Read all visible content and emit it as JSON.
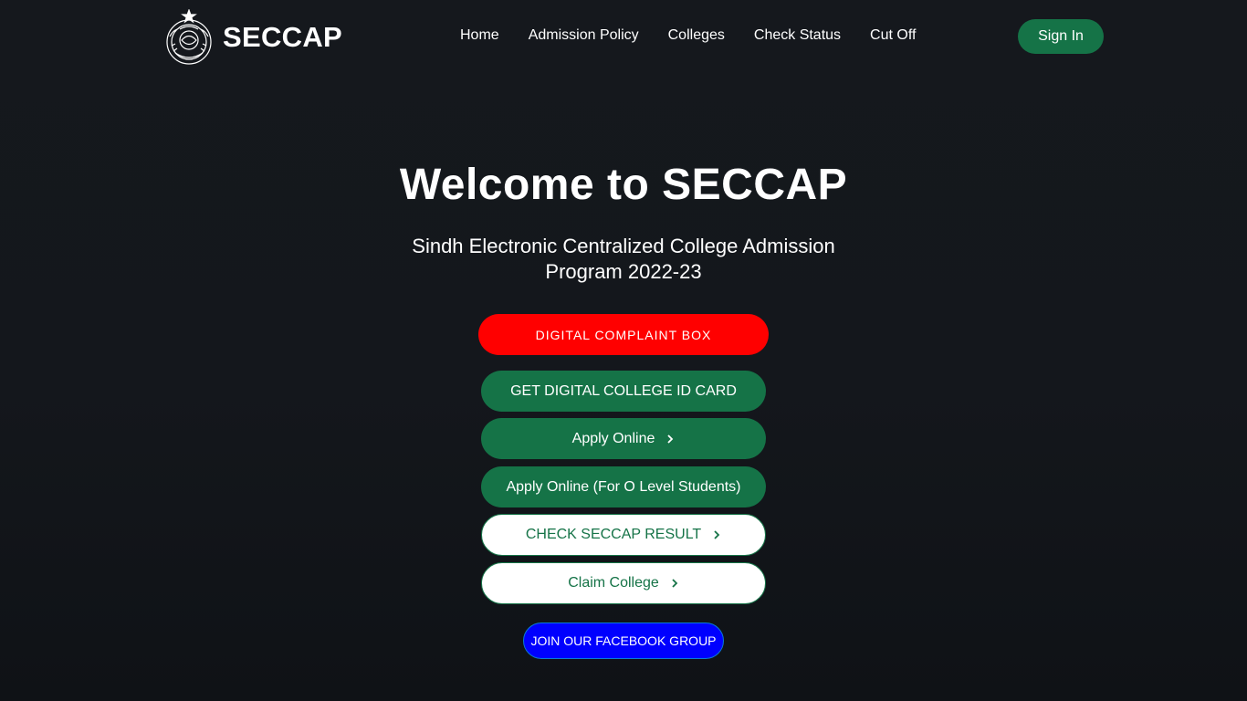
{
  "header": {
    "brand": "SECCAP",
    "nav": [
      "Home",
      "Admission Policy",
      "Colleges",
      "Check Status",
      "Cut Off"
    ],
    "signin_label": "Sign In"
  },
  "hero": {
    "title": "Welcome to SECCAP",
    "subtitle": "Sindh Electronic Centralized College Admission Program 2022-23"
  },
  "buttons": {
    "complaint": "DIGITAL COMPLAINT BOX",
    "id_card": "GET DIGITAL COLLEGE ID CARD",
    "apply_online": "Apply Online",
    "apply_o_level": "Apply Online (For O Level Students)",
    "check_result": "CHECK SECCAP RESULT",
    "claim_college": "Claim College",
    "facebook": "JOIN OUR FACEBOOK GROUP"
  },
  "colors": {
    "background": "#14171c",
    "primary_green": "#157347",
    "complaint_red": "#ff0000",
    "facebook_blue": "#0000ff"
  },
  "icons": [
    "sindh-emblem-logo",
    "chevron-right-icon"
  ]
}
